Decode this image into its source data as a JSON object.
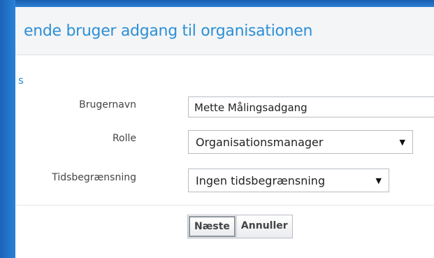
{
  "dialog": {
    "title": "ende bruger adgang til organisationen",
    "section_label": "s"
  },
  "form": {
    "username_label": "Brugernavn",
    "username_value": "Mette Målingsadgang",
    "role_label": "Rolle",
    "role_value": "Organisationsmanager",
    "time_limit_label": "Tidsbegrænsning",
    "time_limit_value": "Ingen tidsbegrænsning"
  },
  "buttons": {
    "next_label": "Næste",
    "cancel_label": "Annuller"
  },
  "icons": {
    "dropdown": "caret-down-icon"
  },
  "colors": {
    "frame": "#1e6fc2",
    "title": "#2d8fd5"
  }
}
